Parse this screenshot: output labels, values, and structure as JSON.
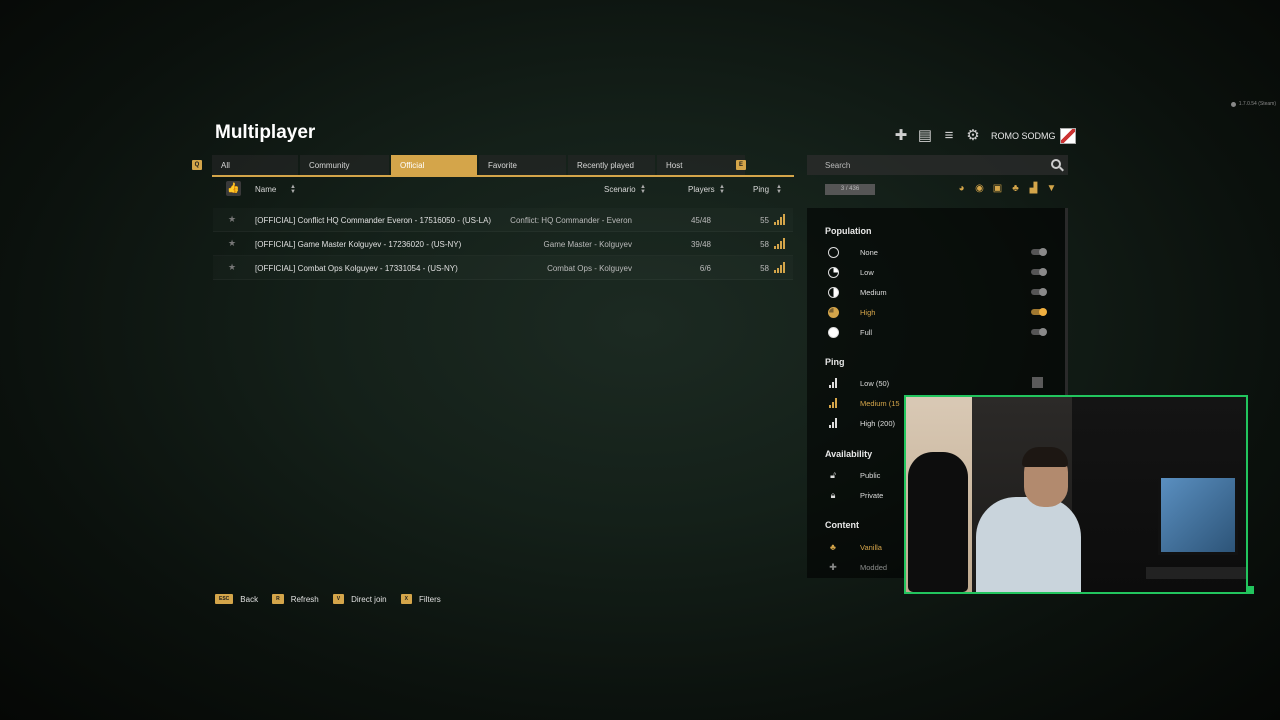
{
  "version": "1.7.0.54 (Steam)",
  "title": "Multiplayer",
  "user": {
    "name": "ROMO SODMG"
  },
  "tabs": {
    "left_key": "Q",
    "right_key": "E",
    "items": [
      {
        "label": "All",
        "active": false
      },
      {
        "label": "Community",
        "active": false
      },
      {
        "label": "Official",
        "active": true
      },
      {
        "label": "Favorite",
        "active": false
      },
      {
        "label": "Recently played",
        "active": false
      },
      {
        "label": "Host",
        "active": false
      }
    ]
  },
  "columns": {
    "name": "Name",
    "scenario": "Scenario",
    "players": "Players",
    "ping": "Ping"
  },
  "servers": [
    {
      "name": "[OFFICIAL] Conflict HQ Commander Everon - 17516050 - (US-LA)",
      "scenario": "Conflict: HQ Commander - Everon",
      "players": "45/48",
      "ping": "55"
    },
    {
      "name": "[OFFICIAL] Game Master Kolguyev - 17236020 - (US-NY)",
      "scenario": "Game Master - Kolguyev",
      "players": "39/48",
      "ping": "58"
    },
    {
      "name": "[OFFICIAL] Combat Ops Kolguyev - 17331054 - (US-NY)",
      "scenario": "Combat Ops - Kolguyev",
      "players": "6/6",
      "ping": "58"
    }
  ],
  "search": {
    "placeholder": "Search"
  },
  "server_count": "3 / 436",
  "filters": {
    "population": {
      "title": "Population",
      "options": [
        {
          "label": "None",
          "on": false
        },
        {
          "label": "Low",
          "on": false
        },
        {
          "label": "Medium",
          "on": false
        },
        {
          "label": "High",
          "on": true
        },
        {
          "label": "Full",
          "on": false
        }
      ]
    },
    "ping": {
      "title": "Ping",
      "options": [
        {
          "label": "Low (50)",
          "on": false
        },
        {
          "label": "Medium (15",
          "on": true
        },
        {
          "label": "High (200)",
          "on": false
        }
      ]
    },
    "availability": {
      "title": "Availability",
      "options": [
        {
          "label": "Public"
        },
        {
          "label": "Private"
        }
      ]
    },
    "content": {
      "title": "Content",
      "options": [
        {
          "label": "Vanilla",
          "on": true
        },
        {
          "label": "Modded",
          "on": false
        }
      ]
    }
  },
  "footer": [
    {
      "key": "ESC",
      "label": "Back"
    },
    {
      "key": "R",
      "label": "Refresh"
    },
    {
      "key": "V",
      "label": "Direct join"
    },
    {
      "key": "X",
      "label": "Filters"
    }
  ],
  "colors": {
    "accent": "#d4a54a",
    "webcam_border": "#22c55e"
  }
}
